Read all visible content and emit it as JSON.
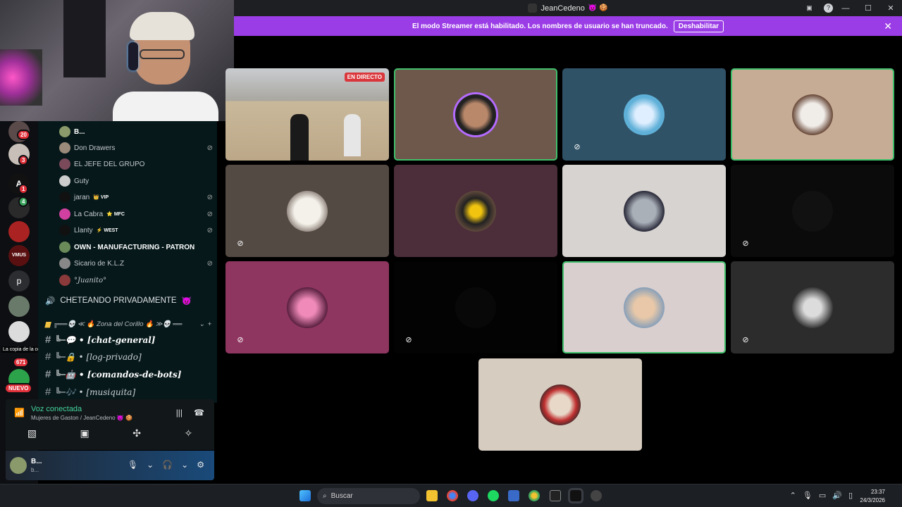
{
  "window": {
    "title": "JeanCedeno",
    "controls": [
      "—",
      "☐",
      "✕"
    ]
  },
  "banner": {
    "text": "El modo Streamer está habilitado. Los nombres de usuario se han truncado.",
    "button": "Deshabilitar"
  },
  "servers": [
    {
      "label": "",
      "badge": "20"
    },
    {
      "label": "",
      "badge": "3"
    },
    {
      "label": "A",
      "badge": "1"
    },
    {
      "label": "",
      "badge": "4"
    },
    {
      "label": "",
      "badge": ""
    },
    {
      "label": "VMUS",
      "badge": ""
    },
    {
      "label": "p",
      "badge": ""
    },
    {
      "label": "",
      "badge": ""
    },
    {
      "label": "",
      "badge": "671"
    },
    {
      "label": "",
      "badge": "NUEVO"
    }
  ],
  "toast": "La copia de la copia xddddddddd",
  "voice_members": [
    {
      "name": "B...",
      "tag": "",
      "muted": false
    },
    {
      "name": "Don Drawers",
      "tag": "",
      "muted": true
    },
    {
      "name": "EL JEFE DEL GRUPO",
      "tag": "",
      "muted": false
    },
    {
      "name": "Guty",
      "tag": "",
      "muted": false
    },
    {
      "name": "jaran",
      "tag": "VIP",
      "muted": true
    },
    {
      "name": "La Cabra",
      "tag": "MFC",
      "muted": true
    },
    {
      "name": "Llanty",
      "tag": "WEST",
      "muted": true
    },
    {
      "name": "OWN - MANUFACTURING - PATRON",
      "tag": "",
      "muted": false
    },
    {
      "name": "Sicario de K.L.Z",
      "tag": "",
      "muted": true
    },
    {
      "name": "°Juanito°",
      "tag": "",
      "muted": false
    }
  ],
  "voice_channel": "CHETEANDO PRIVADAMENTE",
  "category": "╔══💀 ≪ 🔥 Zona del Corillo 🔥 ≫💀 ══",
  "text_channels": [
    {
      "label": "╚─💬 • [chat-general]",
      "active": true
    },
    {
      "label": "╚─🔒 • [log-privado]",
      "active": false
    },
    {
      "label": "╚─🤖 • [comandos-de-bots]",
      "active": true
    },
    {
      "label": "╚─🎶 • [musiquita]",
      "active": false
    }
  ],
  "voice_panel": {
    "status": "Voz conectada",
    "location": "Mujeres de Gaston / JeanCedeno 😈 🍪"
  },
  "user": {
    "name": "B...",
    "status": "b..."
  },
  "grid": {
    "live_label": "EN DIRECTO",
    "tiles": [
      {
        "bg": "game",
        "muted": false,
        "speaking": false,
        "live": true
      },
      {
        "bg": "#6e584c",
        "muted": false,
        "speaking": true,
        "live": false
      },
      {
        "bg": "#2f5266",
        "muted": true,
        "speaking": false,
        "live": false
      },
      {
        "bg": "#c7ac95",
        "muted": false,
        "speaking": true,
        "live": false
      },
      {
        "bg": "#544a44",
        "muted": true,
        "speaking": false,
        "live": false
      },
      {
        "bg": "#4c2d3a",
        "muted": false,
        "speaking": false,
        "live": false
      },
      {
        "bg": "#d7d3d0",
        "muted": false,
        "speaking": false,
        "live": false
      },
      {
        "bg": "#0b0b0b",
        "muted": true,
        "speaking": false,
        "live": false
      },
      {
        "bg": "#8e3660",
        "muted": true,
        "speaking": false,
        "live": false
      },
      {
        "bg": "#030303",
        "muted": true,
        "speaking": false,
        "live": false
      },
      {
        "bg": "#d9cfcf",
        "muted": false,
        "speaking": true,
        "live": false
      },
      {
        "bg": "#2c2c2c",
        "muted": true,
        "speaking": false,
        "live": false
      },
      {
        "bg": "#d6ccc0",
        "muted": false,
        "speaking": false,
        "live": false
      }
    ]
  },
  "taskbar": {
    "search": "Buscar",
    "time": "23:37",
    "date": "24/3/2026"
  }
}
